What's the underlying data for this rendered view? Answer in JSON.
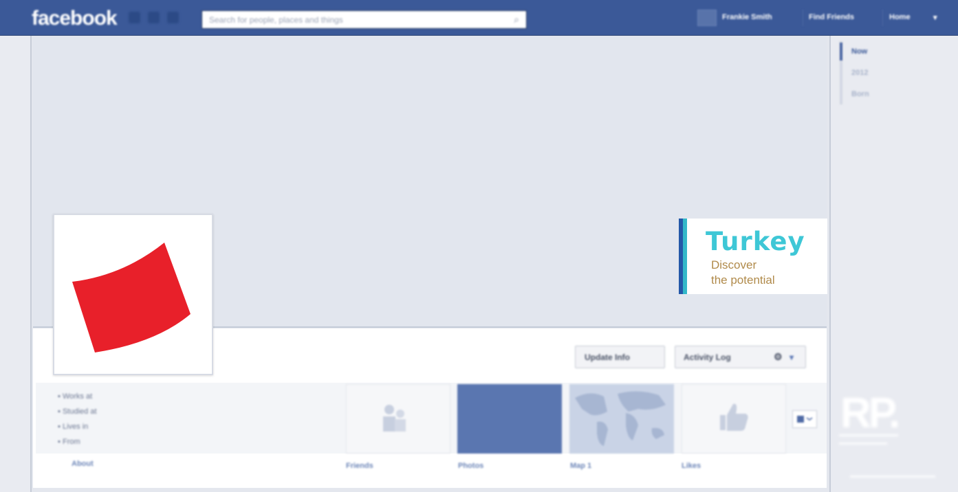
{
  "topbar": {
    "logo": "facebook",
    "search_placeholder": "Search for people, places and things",
    "user_name": "Frankie Smith",
    "find_friends": "Find Friends",
    "home": "Home",
    "menu_caret": "▾",
    "color": "#3b5998"
  },
  "ad": {
    "brand": "Turkey",
    "tagline_line1": "Discover",
    "tagline_line2": "the potential"
  },
  "actions": {
    "update_info": "Update Info",
    "activity_log": "Activity Log",
    "gear": "⚙",
    "caret": "▾"
  },
  "about": {
    "items": [
      "Works at",
      "Studied at",
      "Lives in",
      "From"
    ],
    "label": "About"
  },
  "tiles": {
    "friends": "Friends",
    "photos": "Photos",
    "map": "Map 1",
    "likes": "Likes"
  },
  "timeline": {
    "items": [
      "Now",
      "2012",
      "Born"
    ]
  },
  "watermark": {
    "logo": "RP."
  },
  "colors": {
    "logo_red": "#e8202a",
    "ad_turquoise": "#3ec7d6",
    "ad_gold": "#b08a4a",
    "link_blue": "#6d86b8"
  }
}
